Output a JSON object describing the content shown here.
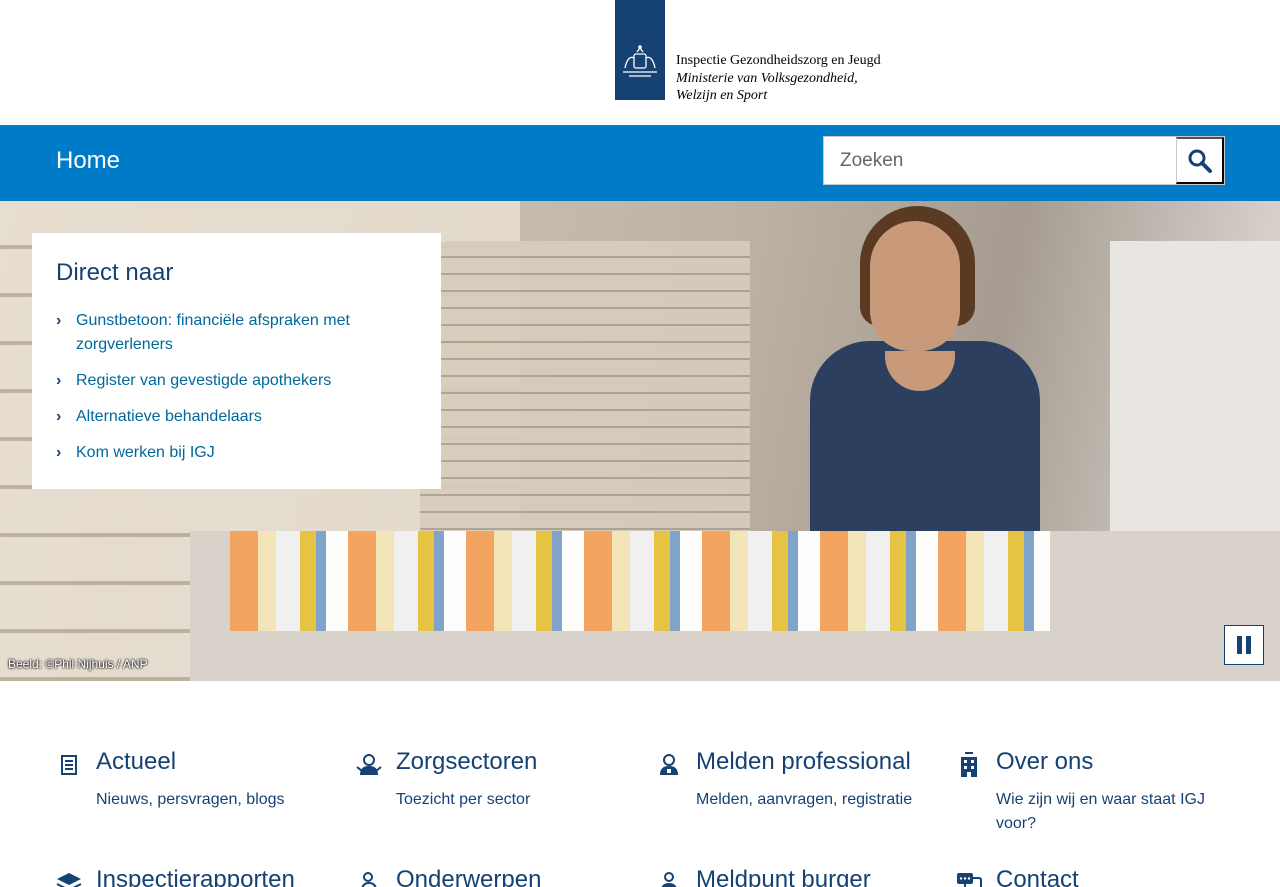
{
  "header": {
    "logo": {
      "line1": "Inspectie Gezondheidszorg en Jeugd",
      "line2": "Ministerie van Volksgezondheid,",
      "line3": "Welzijn en Sport"
    }
  },
  "nav": {
    "home_label": "Home",
    "search_placeholder": "Zoeken"
  },
  "hero": {
    "direct": {
      "title": "Direct naar",
      "items": [
        "Gunstbetoon: financiële afspraken met zorgverleners",
        "Register van gevestigde apothekers",
        "Alternatieve behandelaars",
        "Kom werken bij IGJ"
      ]
    },
    "credit": "Beeld: ©Phil Nijhuis / ANP"
  },
  "tiles": [
    {
      "title": "Actueel",
      "subtitle": "Nieuws, persvragen, blogs",
      "icon": "newspaper-icon"
    },
    {
      "title": "Zorgsectoren",
      "subtitle": "Toezicht per sector",
      "icon": "care-worker-icon"
    },
    {
      "title": "Melden professional",
      "subtitle": "Melden, aanvragen, registratie",
      "icon": "professional-icon"
    },
    {
      "title": "Over ons",
      "subtitle": "Wie zijn wij en waar staat IGJ voor?",
      "icon": "building-icon"
    },
    {
      "title": "Inspectierapporten",
      "subtitle": "",
      "icon": "layers-icon"
    },
    {
      "title": "Onderwerpen",
      "subtitle": "",
      "icon": "topics-icon"
    },
    {
      "title": "Meldpunt burger",
      "subtitle": "",
      "icon": "citizen-icon"
    },
    {
      "title": "Contact",
      "subtitle": "",
      "icon": "chat-icon"
    }
  ],
  "colors": {
    "primary": "#154273",
    "navbar": "#007bc7",
    "link": "#01689b"
  }
}
